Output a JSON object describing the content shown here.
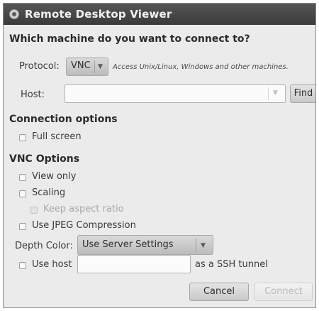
{
  "window": {
    "title": "Remote Desktop Viewer"
  },
  "prompt": "Which machine do you want to connect to?",
  "protocol": {
    "label": "Protocol:",
    "selected": "VNC",
    "description": "Access Unix/Linux, Windows and other machines."
  },
  "host": {
    "label": "Host:",
    "value": "",
    "find_label": "Find"
  },
  "connection_options": {
    "heading": "Connection options",
    "full_screen": {
      "label": "Full screen",
      "checked": false
    }
  },
  "vnc_options": {
    "heading": "VNC Options",
    "view_only": {
      "label": "View only",
      "checked": false
    },
    "scaling": {
      "label": "Scaling",
      "checked": false
    },
    "keep_aspect": {
      "label": "Keep aspect ratio",
      "checked": false,
      "enabled": false
    },
    "jpeg": {
      "label": "Use JPEG Compression",
      "checked": false
    },
    "depth_color": {
      "label": "Depth Color:",
      "selected": "Use Server Settings"
    },
    "ssh": {
      "label": "Use host",
      "value": "",
      "suffix": "as a SSH tunnel",
      "checked": false
    }
  },
  "buttons": {
    "cancel": "Cancel",
    "connect": "Connect"
  }
}
